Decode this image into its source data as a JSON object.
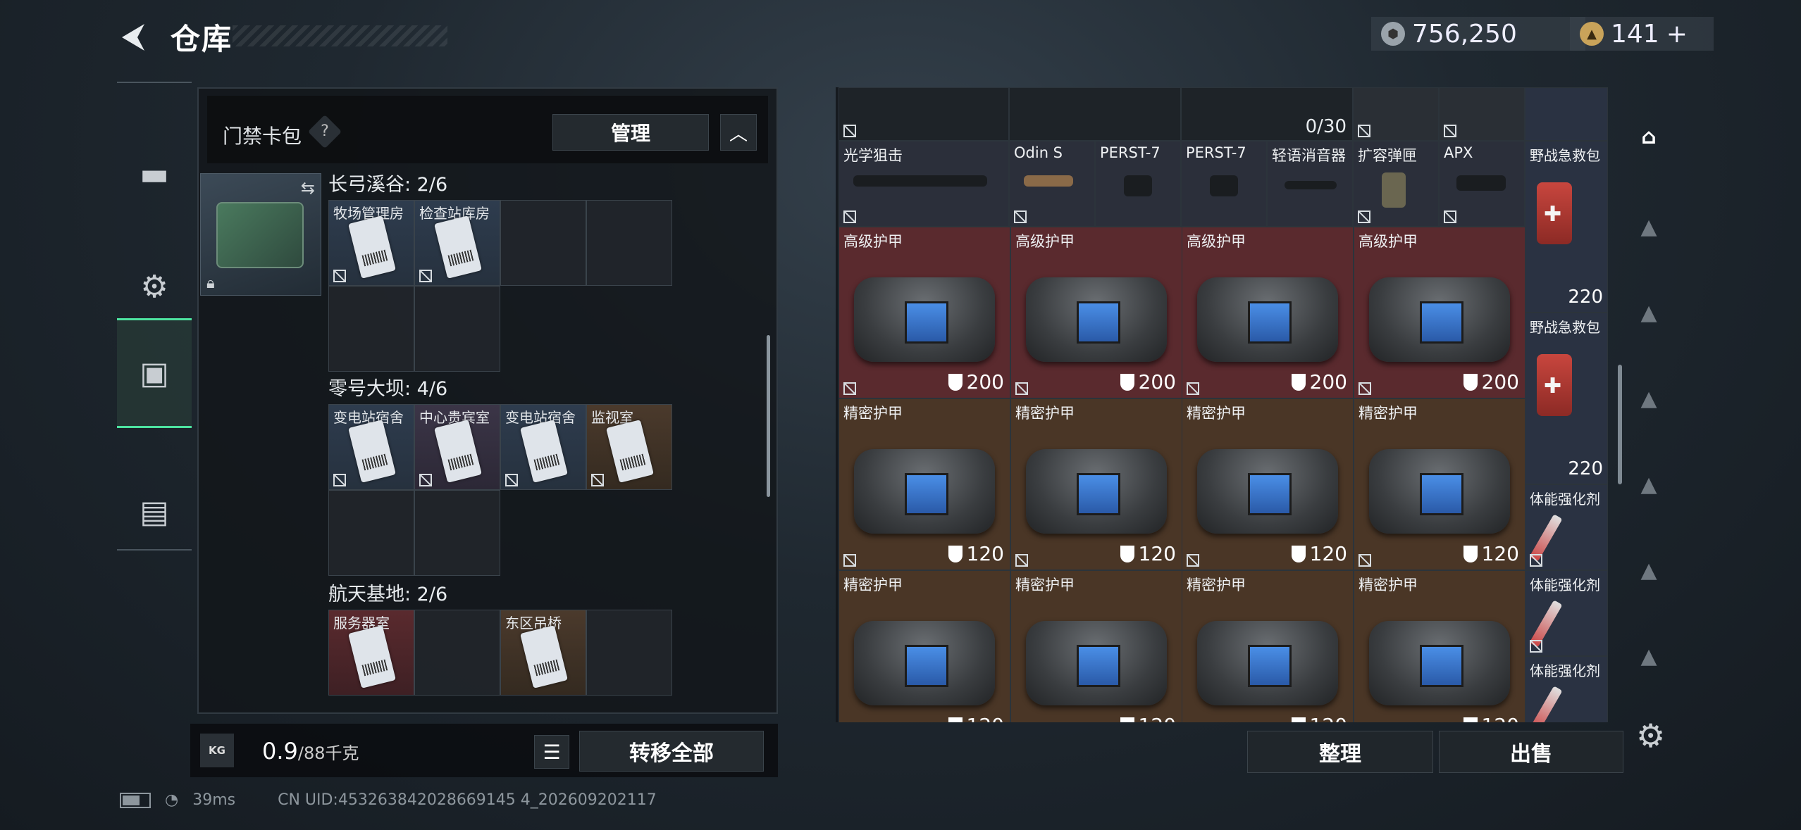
{
  "header": {
    "title": "仓库",
    "currency_silver": "756,250",
    "currency_gold": "141",
    "gold_plus": "+"
  },
  "left_nav": {
    "items": [
      "gun-icon",
      "backpack-icon",
      "storage-icon",
      "toolbox-icon"
    ],
    "active_index": 2
  },
  "keycard_pack": {
    "title": "门禁卡包",
    "help": "?",
    "manage_label": "管理",
    "zones": [
      {
        "title": "长弓溪谷: 2/6",
        "slots": [
          {
            "label": "牧场管理房",
            "rarity": "blue"
          },
          {
            "label": "检查站库房",
            "rarity": "blue"
          },
          {
            "label": "",
            "rarity": "empty"
          },
          {
            "label": "",
            "rarity": "empty"
          },
          {
            "label": "",
            "rarity": "empty"
          },
          {
            "label": "",
            "rarity": "empty"
          }
        ]
      },
      {
        "title": "零号大坝: 4/6",
        "slots": [
          {
            "label": "变电站宿舍",
            "rarity": "blue"
          },
          {
            "label": "中心贵宾室",
            "rarity": "purple"
          },
          {
            "label": "变电站宿舍",
            "rarity": "blue"
          },
          {
            "label": "监视室",
            "rarity": "gold"
          },
          {
            "label": "",
            "rarity": "empty"
          },
          {
            "label": "",
            "rarity": "empty"
          }
        ]
      },
      {
        "title": "航天基地: 2/6",
        "slots": [
          {
            "label": "服务器室",
            "rarity": "red"
          },
          {
            "label": "",
            "rarity": "empty"
          },
          {
            "label": "东区吊桥",
            "rarity": "gold"
          },
          {
            "label": "",
            "rarity": "empty"
          }
        ]
      }
    ]
  },
  "left_footer": {
    "weight_current": "0.9",
    "weight_max": "/88千克",
    "kg_badge": "KG",
    "transfer_all_label": "转移全部"
  },
  "storage": {
    "top_row_count": "0/30",
    "attachments": [
      {
        "label": "光学狙击",
        "color": "#2b2f3a"
      },
      {
        "label": "Odin S",
        "color": "#2b2f3a"
      },
      {
        "label": "PERST-7",
        "color": "#2b2f3a"
      },
      {
        "label": "PERST-7",
        "color": "#2b2f3a"
      },
      {
        "label": "轻语消音器",
        "color": "#2b2f3a"
      },
      {
        "label": "扩容弹匣",
        "color": "#2b2f3a"
      },
      {
        "label": "APX",
        "color": "#2b2f3a"
      }
    ],
    "armor_rows": [
      {
        "label": "高级护甲",
        "durability": "200",
        "color": "#5a2a2e"
      },
      {
        "label": "精密护甲",
        "durability": "120",
        "color": "#4a3626"
      },
      {
        "label": "精密护甲",
        "durability": "120",
        "color": "#4a3626"
      }
    ],
    "side_items": [
      {
        "label": "野战急救包",
        "value": "220"
      },
      {
        "label": "野战急救包",
        "value": "220"
      },
      {
        "label": "体能强化剂",
        "value": ""
      },
      {
        "label": "体能强化剂",
        "value": ""
      },
      {
        "label": "体能强化剂",
        "value": ""
      }
    ],
    "sort_label": "整理",
    "sell_label": "出售"
  },
  "category_bar": [
    "all-icon",
    "gtl-icon",
    "iv-icon",
    "iv-icon",
    "iv-icon",
    "iv-icon",
    "iv-icon"
  ],
  "status_bar": {
    "ping": "39ms",
    "uid": "CN UID:453263842028669145 4_202609202117"
  }
}
